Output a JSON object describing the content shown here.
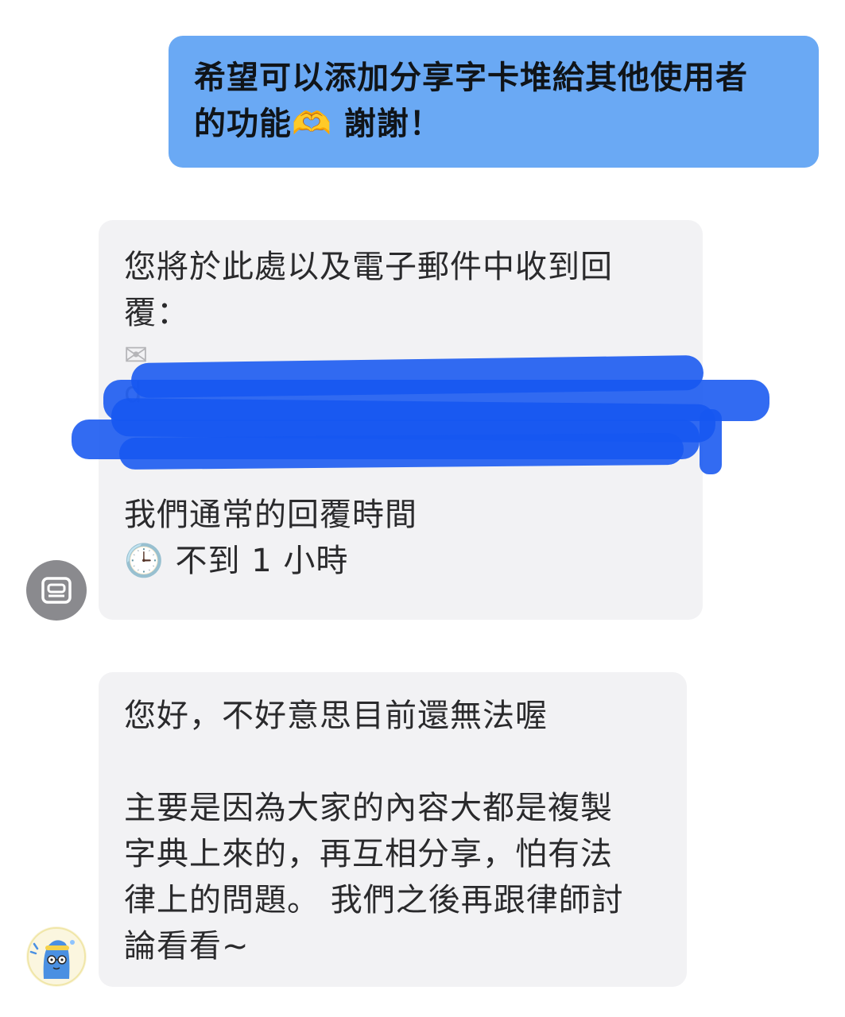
{
  "conversation": {
    "user_message": {
      "line1": "希望可以添加分享字卡堆給其他使用者",
      "line2_before": "的功能",
      "line2_emoji": "🫶",
      "line2_after": " 謝謝！"
    },
    "auto_reply": {
      "line1": "您將於此處以及電子郵件中收到回",
      "line2": "覆：",
      "envelope_icon": "✉",
      "email_redacted": "d",
      "response_label": "我們通常的回覆時間",
      "clock_icon": "🕒",
      "response_time": "不到 1 小時"
    },
    "agent_reply": {
      "line1": "您好，不好意思目前還無法喔",
      "line2": "主要是因為大家的內容大都是複製",
      "line3": "字典上來的，再互相分享，怕有法",
      "line4": "律上的問題。 我們之後再跟律師討",
      "line5": "論看看~"
    }
  },
  "colors": {
    "user_bubble": "#6aa9f4",
    "bot_bubble": "#f2f2f4",
    "redaction": "#1656f0",
    "bot_avatar": "#8a8a8e"
  },
  "icons": {
    "bot_avatar": "bot-avatar-icon",
    "agent_avatar": "mascot-avatar-icon"
  }
}
